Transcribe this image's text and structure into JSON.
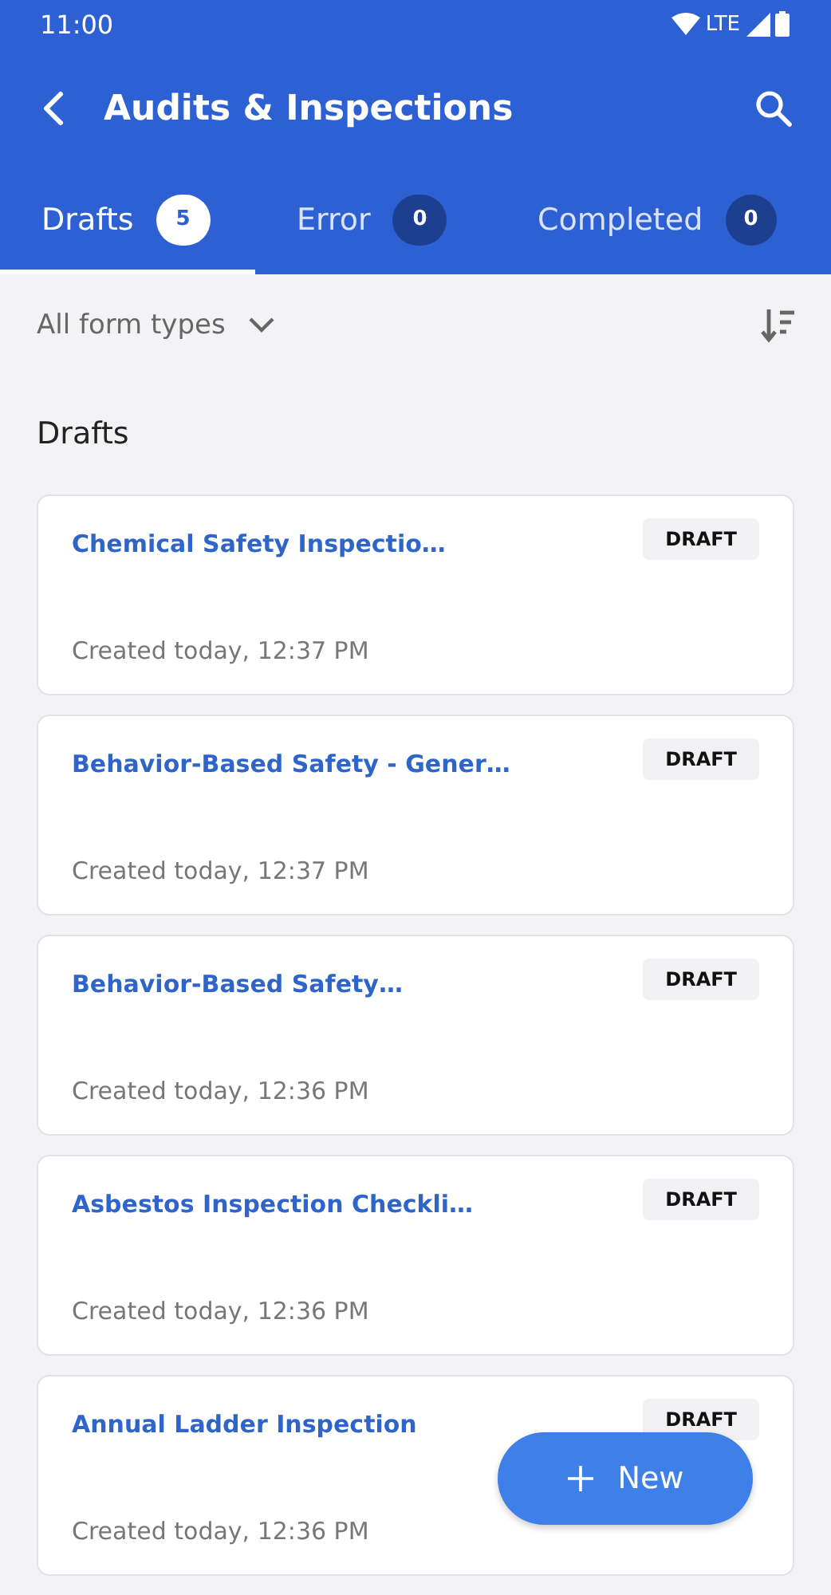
{
  "status_bar": {
    "time": "11:00",
    "network": "LTE"
  },
  "app_bar": {
    "title": "Audits & Inspections"
  },
  "tabs": [
    {
      "label": "Drafts",
      "count": "5",
      "selected": true
    },
    {
      "label": "Error",
      "count": "0",
      "selected": false
    },
    {
      "label": "Completed",
      "count": "0",
      "selected": false
    }
  ],
  "filter": {
    "label": "All form types"
  },
  "section_title": "Drafts",
  "cards": [
    {
      "title": "Chemical Safety Inspectio…",
      "badge": "DRAFT",
      "created": "Created today,  12:37 PM"
    },
    {
      "title": "Behavior-Based Safety - Gener…",
      "badge": "DRAFT",
      "created": "Created today,  12:37 PM"
    },
    {
      "title": "Behavior-Based Safety…",
      "badge": "DRAFT",
      "created": "Created today,  12:36 PM"
    },
    {
      "title": "Asbestos Inspection Checkli…",
      "badge": "DRAFT",
      "created": "Created today,  12:36 PM"
    },
    {
      "title": "Annual Ladder Inspection",
      "badge": "DRAFT",
      "created": "Created today,  12:36 PM"
    }
  ],
  "fab": {
    "label": "New"
  }
}
